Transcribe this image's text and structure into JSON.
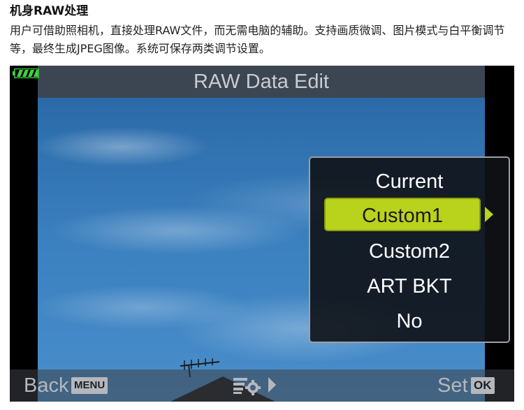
{
  "article": {
    "title": "机身RAW处理",
    "description": "用户可借助照相机，直接处理RAW文件，而无需电脑的辅助。支持画质微调、图片模式与白平衡调节等，最终生成JPEG图像。系统可保存两类调节设置。"
  },
  "camera": {
    "title": "RAW Data Edit",
    "battery_color": "#3fd43f",
    "accent_color": "#b9d21c",
    "menu": {
      "items": [
        {
          "label": "Current",
          "selected": false
        },
        {
          "label": "Custom1",
          "selected": true
        },
        {
          "label": "Custom2",
          "selected": false
        },
        {
          "label": "ART BKT",
          "selected": false
        },
        {
          "label": "No",
          "selected": false
        }
      ]
    },
    "bottom": {
      "back_label": "Back",
      "menu_key": "MENU",
      "edit_icon": "edit-settings-icon",
      "arrow_icon": "right-arrow-icon",
      "set_label": "Set",
      "ok_key": "OK"
    }
  }
}
